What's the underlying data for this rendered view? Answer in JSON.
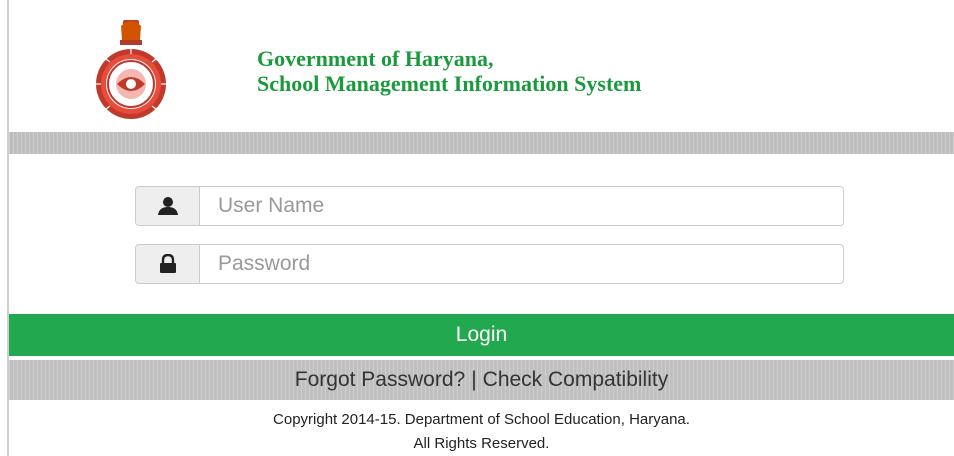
{
  "header": {
    "emblem_icon": "haryana-state-emblem",
    "title_line1": "Government of Haryana,",
    "title_line2": "School Management Information System",
    "title_color": "#1a9a3c"
  },
  "login_form": {
    "username": {
      "icon": "user-icon",
      "value": "",
      "placeholder": "User Name"
    },
    "password": {
      "icon": "lock-icon",
      "value": "",
      "placeholder": "Password"
    },
    "login_label": "Login",
    "login_color": "#22a94f"
  },
  "links": {
    "forgot_password": "Forgot Password?",
    "separator": "|",
    "check_compatibility": "Check Compatibility"
  },
  "footer": {
    "copyright_line1": "Copyright 2014-15. Department of School Education, Haryana.",
    "copyright_line2": "All Rights Reserved."
  }
}
